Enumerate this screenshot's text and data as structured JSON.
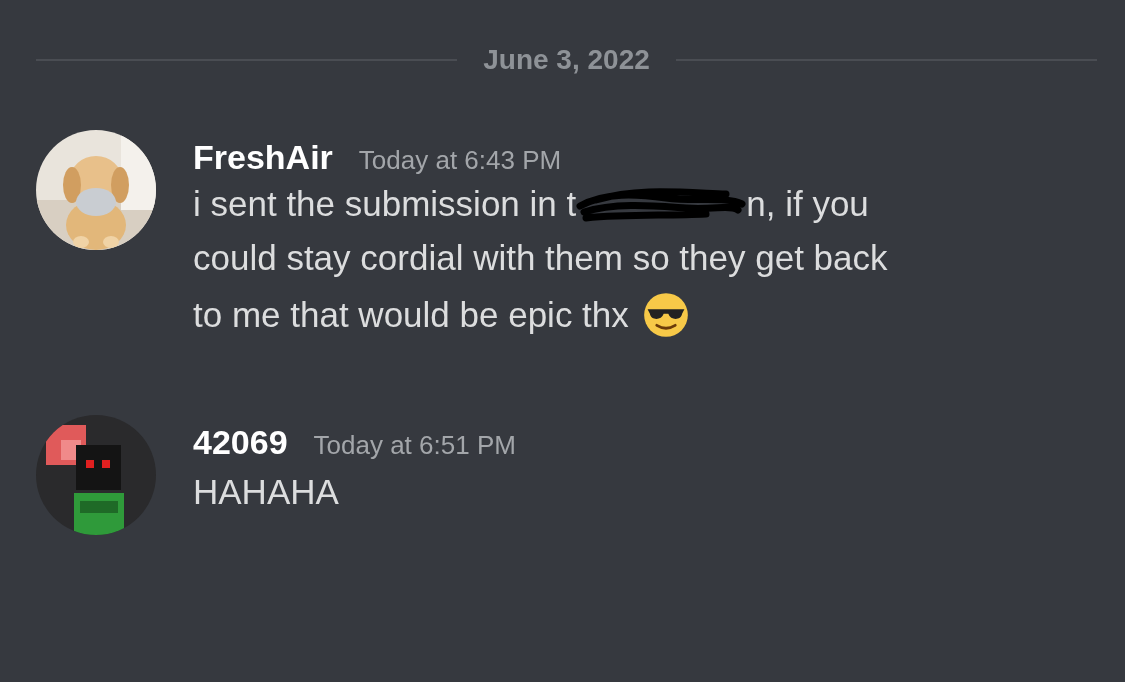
{
  "date_divider": "June 3, 2022",
  "messages": [
    {
      "author": "FreshAir",
      "timestamp": "Today at 6:43 PM",
      "avatar": {
        "kind": "picture"
      },
      "lines": [
        [
          {
            "kind": "text",
            "text": "i sent the submission in t"
          },
          {
            "kind": "redaction"
          },
          {
            "kind": "text",
            "text": "n, if you"
          }
        ],
        [
          {
            "kind": "text",
            "text": "could stay cordial with them so they get back"
          }
        ],
        [
          {
            "kind": "text",
            "text": "to me that would be epic thx"
          },
          {
            "kind": "emoji"
          }
        ]
      ]
    },
    {
      "author": "42069",
      "timestamp": "Today at 6:51 PM",
      "avatar": {
        "kind": "picture"
      },
      "lines": [
        [
          {
            "kind": "text",
            "text": "HAHAHA"
          }
        ]
      ]
    }
  ]
}
